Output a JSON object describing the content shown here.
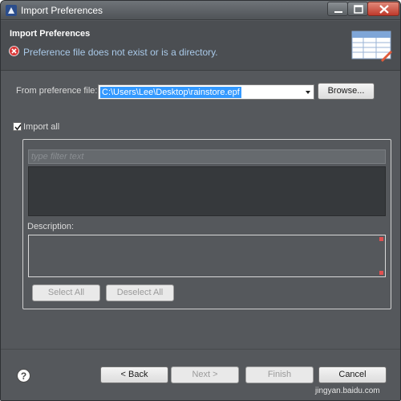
{
  "window": {
    "title": "Import Preferences",
    "controls": {
      "minimize_icon": "minimize-icon",
      "maximize_icon": "maximize-icon",
      "close_icon": "close-icon"
    }
  },
  "header": {
    "title": "Import Preferences",
    "error_message": "Preference file does not exist or is a directory.",
    "error_icon": "error-icon",
    "banner_icon": "import-preferences-wizard-icon"
  },
  "form": {
    "file_label": "From preference file:",
    "file_value": "C:\\Users\\Lee\\Desktop\\rainstore.epf",
    "browse_label": "Browse...",
    "import_all_label": "Import all",
    "import_all_checked": true
  },
  "group": {
    "filter_placeholder": "type filter text",
    "description_label": "Description:",
    "description_value": "",
    "select_all_label": "Select All",
    "deselect_all_label": "Deselect All"
  },
  "footer": {
    "help_icon": "help-icon",
    "back_label": "< Back",
    "next_label": "Next >",
    "finish_label": "Finish",
    "cancel_label": "Cancel",
    "watermark": "jingyan.baidu.com"
  },
  "colors": {
    "background": "#55585c",
    "selection": "#3399ff",
    "error_text": "#a9c9e8",
    "close_button": "#c0392b"
  }
}
